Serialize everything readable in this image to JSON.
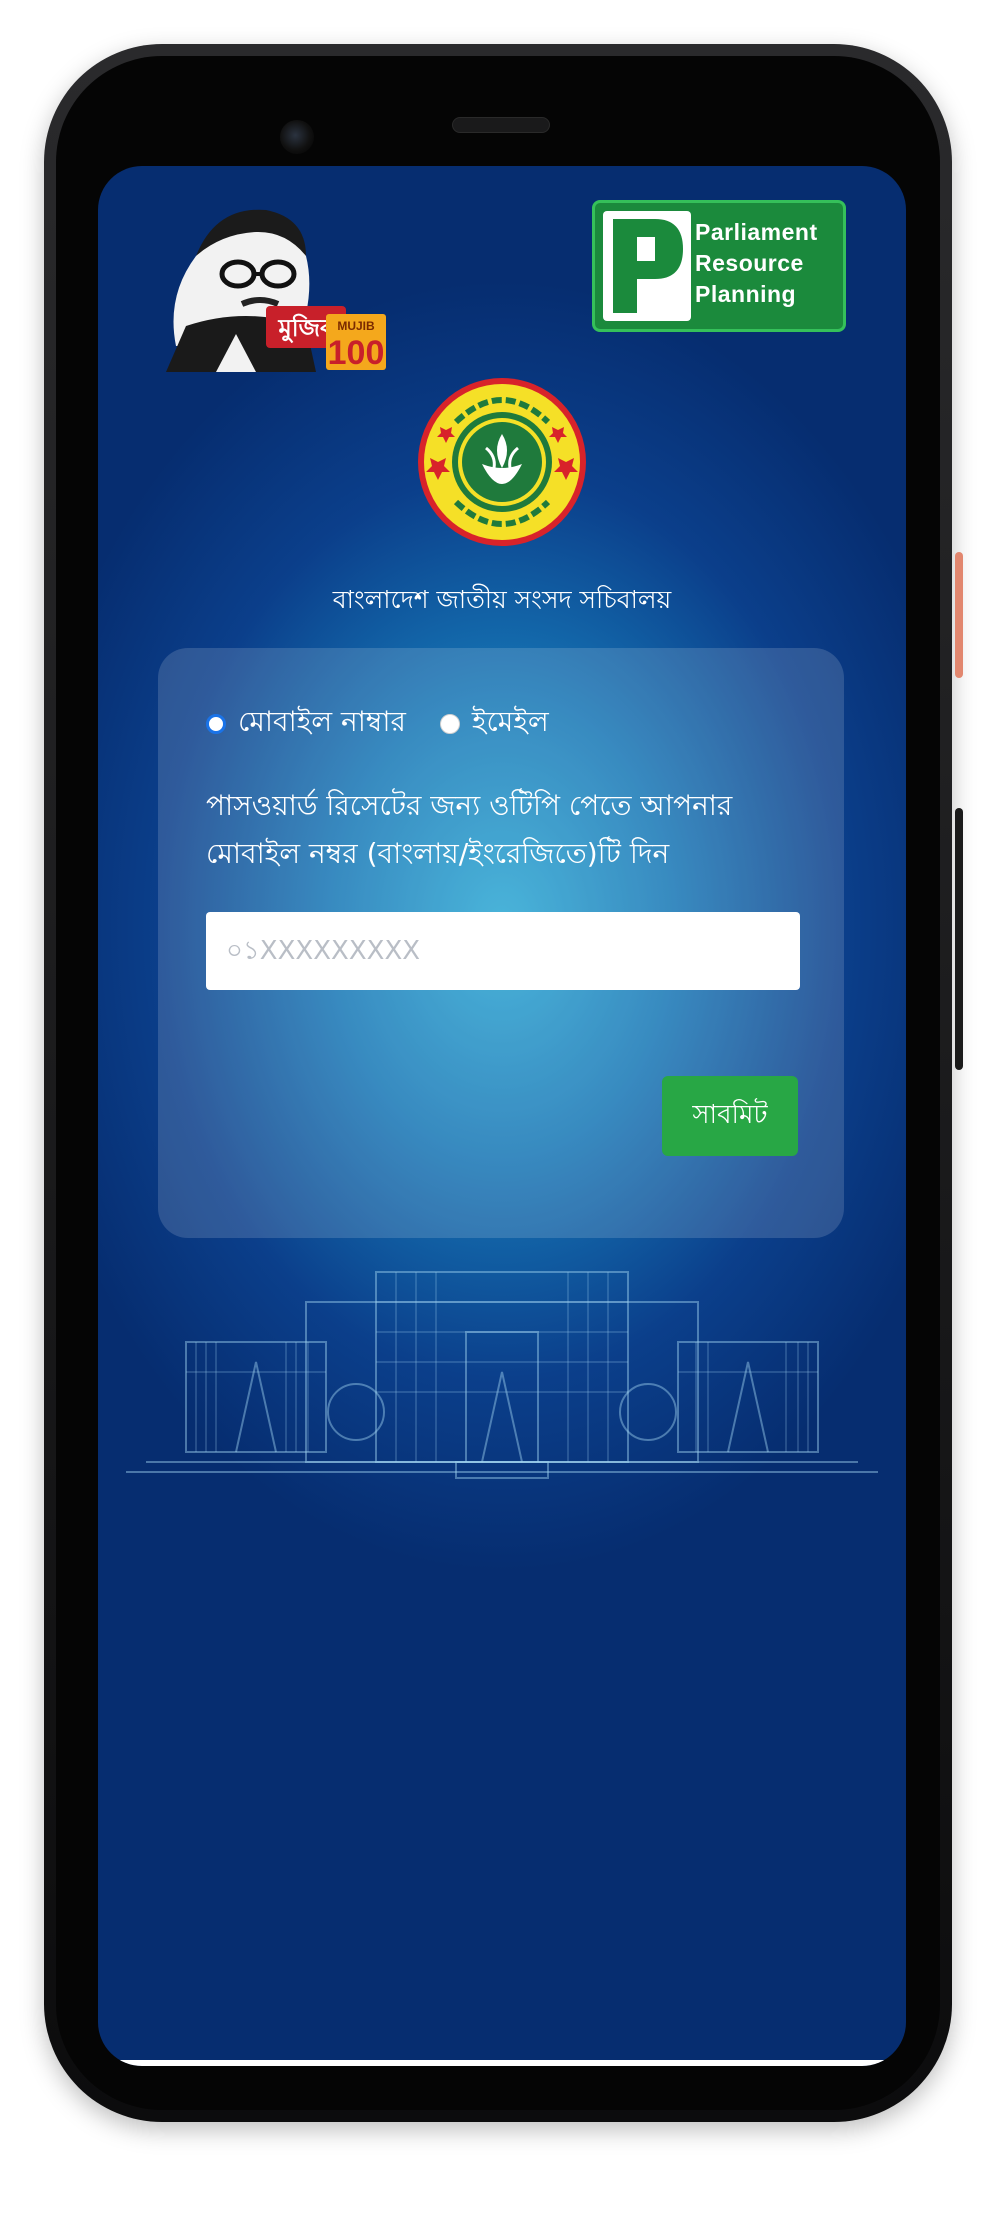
{
  "header": {
    "left_logo_name": "mujib-100-logo",
    "right_logo": {
      "mark": "RP",
      "lines": [
        "Parliament",
        "Resource",
        "Planning"
      ]
    },
    "emblem_name": "parliament-emblem"
  },
  "org_name": "বাংলাদেশ জাতীয় সংসদ সচিবালয়",
  "form": {
    "options": [
      "মোবাইল নাম্বার",
      "ইমেইল"
    ],
    "selected_option": "মোবাইল নাম্বার",
    "instruction": "পাসওয়ার্ড রিসেটের জন্য ওটিপি পেতে আপনার মোবাইল নম্বর (বাংলায়/ইংরেজিতে)টি দিন",
    "phone_placeholder": "০১XXXXXXXXX",
    "phone_value": "",
    "submit_label": "সাবমিট"
  },
  "colors": {
    "background_top": "#062d70",
    "background_glow": "#2aa8d4",
    "submit": "#28a745",
    "prp_green": "#1b8a3c"
  }
}
